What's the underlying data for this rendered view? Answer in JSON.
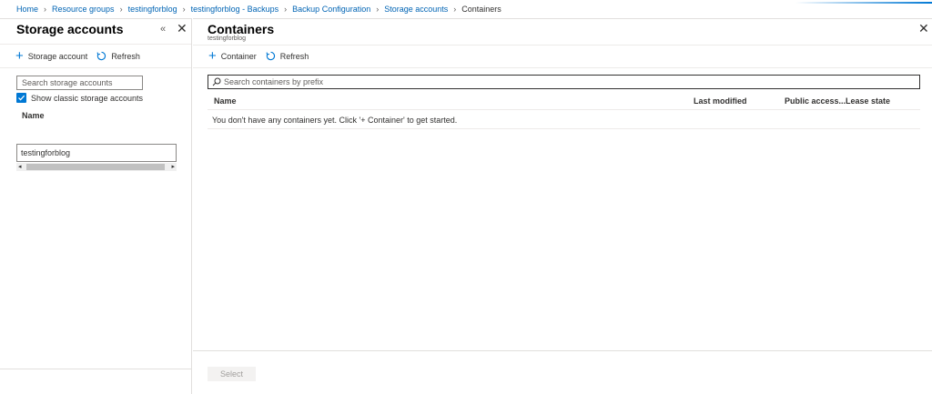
{
  "breadcrumb": {
    "items": [
      "Home",
      "Resource groups",
      "testingforblog",
      "testingforblog - Backups",
      "Backup Configuration",
      "Storage accounts"
    ],
    "current": "Containers"
  },
  "left_blade": {
    "title": "Storage accounts",
    "collapse_icon": "double-chevron-left-icon",
    "toolbar": {
      "add_label": "Storage account",
      "refresh_label": "Refresh"
    },
    "search": {
      "placeholder": "Search storage accounts"
    },
    "show_classic": {
      "label": "Show classic storage accounts",
      "checked": true
    },
    "column_header": "Name",
    "rows": [
      "testingforblog"
    ]
  },
  "right_blade": {
    "title": "Containers",
    "subtitle": "testingforblog",
    "toolbar": {
      "add_label": "Container",
      "refresh_label": "Refresh"
    },
    "search": {
      "placeholder": "Search containers by prefix"
    },
    "columns": [
      "Name",
      "Last modified",
      "Public access...",
      "Lease state"
    ],
    "empty_message": "You don't have any containers yet. Click '+ Container' to get started.",
    "select_label": "Select",
    "select_enabled": false
  },
  "colors": {
    "accent": "#0078d4",
    "link": "#0064b4"
  }
}
